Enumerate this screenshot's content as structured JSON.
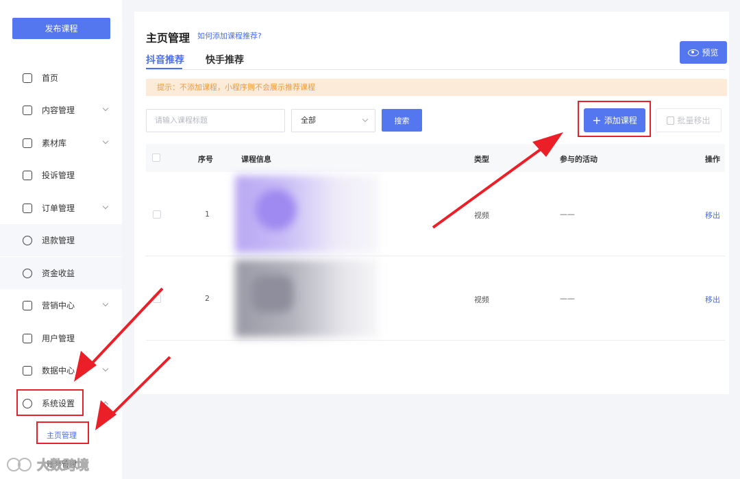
{
  "sidebar": {
    "publish_label": "发布课程",
    "items": [
      {
        "label": "首页",
        "icon": "home-icon"
      },
      {
        "label": "内容管理",
        "icon": "content-icon"
      },
      {
        "label": "素材库",
        "icon": "folder-icon"
      },
      {
        "label": "投诉管理",
        "icon": "complaint-icon"
      },
      {
        "label": "订单管理",
        "icon": "order-icon"
      },
      {
        "label": "退款管理",
        "icon": "refund-icon"
      },
      {
        "label": "资金收益",
        "icon": "money-bag-icon"
      },
      {
        "label": "营销中心",
        "icon": "marketing-icon"
      },
      {
        "label": "用户管理",
        "icon": "user-icon"
      },
      {
        "label": "数据中心",
        "icon": "chart-icon"
      },
      {
        "label": "系统设置",
        "icon": "settings-icon"
      }
    ],
    "submenu": {
      "active": "主页管理",
      "next": "账号管理"
    }
  },
  "header": {
    "title": "主页管理",
    "help_link": "如何添加课程推荐?",
    "preview_label": "预览"
  },
  "tabs": [
    {
      "label": "抖音推荐",
      "active": true
    },
    {
      "label": "快手推荐",
      "active": false
    }
  ],
  "tip": "提示：不添加课程，小程序则不会展示推荐课程",
  "toolbar": {
    "search_placeholder": "请输入课程标题",
    "select_value": "全部",
    "search_label": "搜索",
    "add_label": "添加课程",
    "batch_label": "批量移出"
  },
  "table": {
    "columns": [
      "序号",
      "课程信息",
      "类型",
      "参与的活动",
      "操作"
    ],
    "rows": [
      {
        "index": "1",
        "type": "视频",
        "activity": "——",
        "action": "移出"
      },
      {
        "index": "2",
        "type": "视频",
        "activity": "——",
        "action": "移出"
      }
    ]
  },
  "watermark": "大数跨境",
  "colors": {
    "accent": "#5477f0",
    "annotation": "#e8202a",
    "tip_bg": "#fbebd8",
    "tip_text": "#ef9b3e"
  }
}
